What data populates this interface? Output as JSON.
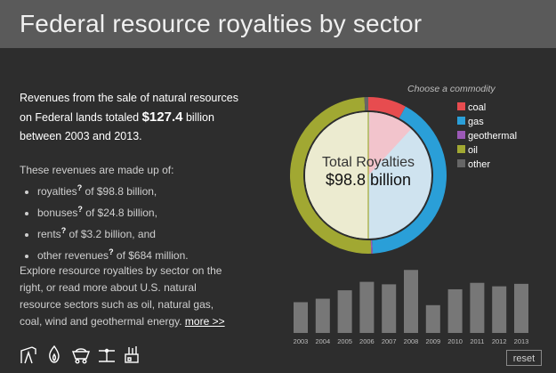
{
  "header": {
    "title": "Federal resource royalties by sector"
  },
  "intro": {
    "line1": "Revenues from the sale of natural resources",
    "line2_prefix": "on Federal lands totaled ",
    "total": "$127.4",
    "line2_suffix": " billion",
    "line3": "between 2003 and 2013."
  },
  "breakdown": {
    "heading": "These revenues are made up of:",
    "items": [
      {
        "label": "royalties",
        "q": "?",
        "text": " of $98.8 billion,"
      },
      {
        "label": "bonuses",
        "q": "?",
        "text": " of $24.8 billion,"
      },
      {
        "label": "rents",
        "q": "?",
        "text": " of $3.2 billion, and"
      },
      {
        "label": "other revenues",
        "q": "?",
        "text": " of $684 million."
      }
    ]
  },
  "explore": {
    "text": "Explore resource royalties by sector on the right, or read more about U.S. natural resource sectors such as oil, natural gas, coal, wind and geothermal energy.",
    "more_link": "more >>"
  },
  "icons": [
    "oil-pump-icon",
    "gas-flame-icon",
    "coal-cart-icon",
    "wind-turbine-icon",
    "geothermal-plant-icon"
  ],
  "reset_label": "reset",
  "chart_data": [
    {
      "type": "pie",
      "title": "Total Royalties",
      "center_value": "$98.8 billion",
      "legend_title": "Choose a commodity",
      "legend_position": "right",
      "labels": [
        "coal",
        "gas",
        "geothermal",
        "oil",
        "other"
      ],
      "colors": [
        "#e74c4f",
        "#2a9fd8",
        "#9b59b6",
        "#a1a832",
        "#666666"
      ],
      "values": [
        7.9,
        41.2,
        0.3,
        49.8,
        0.8
      ],
      "units": "percent of total royalties"
    },
    {
      "type": "bar",
      "categories": [
        "2003",
        "2004",
        "2005",
        "2006",
        "2007",
        "2008",
        "2009",
        "2010",
        "2011",
        "2012",
        "2013"
      ],
      "values": [
        6.2,
        6.9,
        8.6,
        10.3,
        9.8,
        12.7,
        5.6,
        8.8,
        10.1,
        9.4,
        9.9
      ],
      "color": "#777777",
      "ylim": [
        0,
        14
      ]
    }
  ]
}
